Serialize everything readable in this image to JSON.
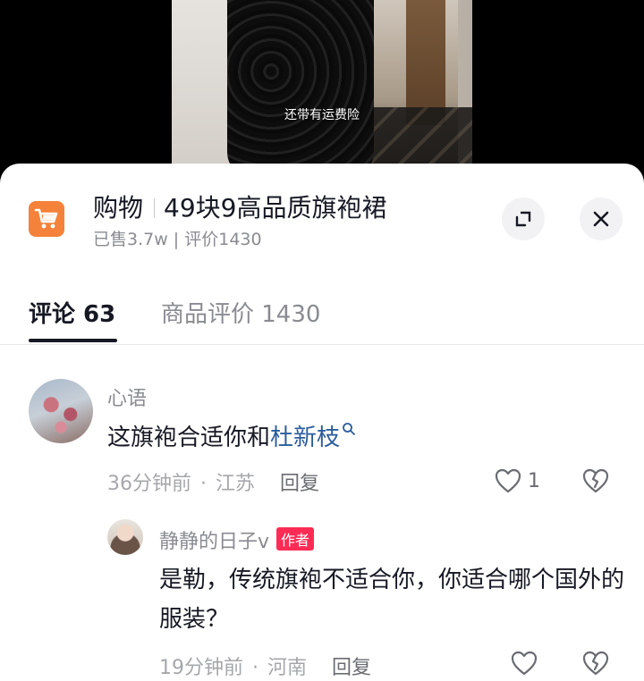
{
  "video": {
    "subtitle": "还带有运费险"
  },
  "product": {
    "category": "购物",
    "title": "49块9高品质旗袍裙",
    "stats": "已售3.7w | 评价1430",
    "accent_color": "#f5823a"
  },
  "tabs": [
    {
      "label": "评论 63",
      "active": true
    },
    {
      "label": "商品评价 1430",
      "active": false
    }
  ],
  "comments": [
    {
      "username": "心语",
      "text_prefix": "这旗袍合适你和",
      "mention": "杜新枝",
      "time": "36分钟前",
      "location": "江苏",
      "reply_label": "回复",
      "likes": "1",
      "replies": [
        {
          "username": "静静的日子v",
          "badge": "作者",
          "text": "是勒，传统旗袍不适合你，你适合哪个国外的服装？",
          "time": "19分钟前",
          "location": "河南",
          "reply_label": "回复"
        }
      ]
    }
  ],
  "icons": {
    "cart": "shopping-cart-icon",
    "expand": "expand-icon",
    "close": "close-icon",
    "like": "heart-icon",
    "dislike": "broken-heart-icon",
    "mention_search": "search-icon"
  },
  "colors": {
    "mention": "#2b5c9c",
    "author_badge": "#fe2c55"
  }
}
